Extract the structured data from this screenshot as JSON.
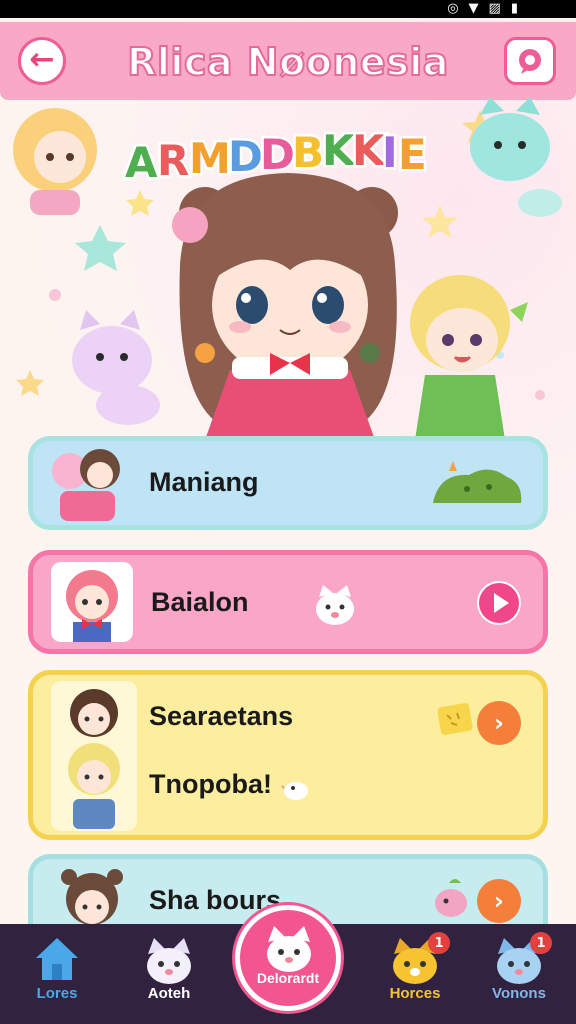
{
  "status_bar": {
    "icons": [
      "signal-icon",
      "wifi-icon",
      "battery-icon"
    ]
  },
  "header": {
    "title": "Rlica Nøonesia",
    "back_icon": "arrow-left-icon",
    "chat_icon": "chat-bubble-icon"
  },
  "banner": {
    "title_letters": [
      "A",
      "R",
      "M",
      "D",
      "D",
      "B",
      "K",
      "K",
      "I",
      "E"
    ],
    "letter_colors": [
      "#4fae4f",
      "#e85c5c",
      "#f2a12f",
      "#5b9be0",
      "#e85c9b",
      "#f5c02f",
      "#4fae4f",
      "#e85c5c",
      "#a06ae0",
      "#f2a12f"
    ]
  },
  "cards": [
    {
      "label": "Maniang",
      "action": "none"
    },
    {
      "label": "Baialon",
      "action": "play"
    },
    {
      "label": "Searaetans",
      "sub_label": "Tnopoba!",
      "action": "next"
    },
    {
      "label": "Sha bours",
      "action": "next"
    }
  ],
  "bottom_nav": {
    "items": [
      {
        "label": "Lores",
        "icon": "home-icon",
        "color": "#4aa8e8"
      },
      {
        "label": "Aoteh",
        "icon": "cat-face-icon",
        "color": "#ffffff"
      },
      {
        "label": "Delorardt",
        "icon": "cat-face-icon",
        "color": "#ffffff"
      },
      {
        "label": "Horces",
        "icon": "dog-face-icon",
        "color": "#f5c430",
        "badge": "1"
      },
      {
        "label": "Vonons",
        "icon": "cat-face-icon",
        "color": "#7fb8e8",
        "badge": "1"
      }
    ]
  }
}
